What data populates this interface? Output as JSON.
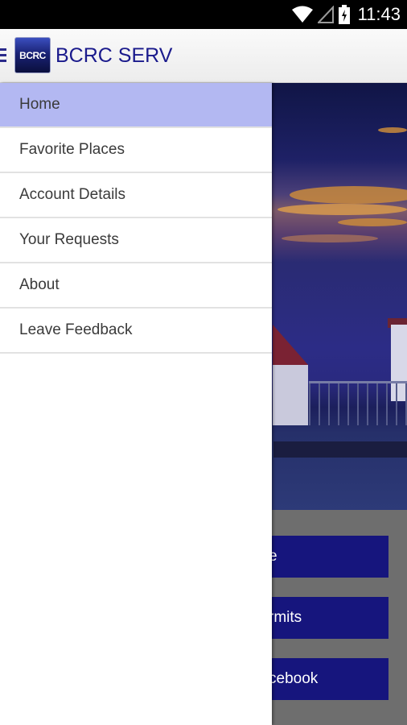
{
  "status_bar": {
    "time": "11:43",
    "icons": [
      "wifi-icon",
      "signal-icon",
      "battery-charging-icon"
    ]
  },
  "action_bar": {
    "logo_text": "BCRC",
    "title": "BCRC SERV"
  },
  "drawer": {
    "items": [
      {
        "label": "Home",
        "selected": true
      },
      {
        "label": "Favorite Places",
        "selected": false
      },
      {
        "label": "Account Details",
        "selected": false
      },
      {
        "label": "Your Requests",
        "selected": false
      },
      {
        "label": "About",
        "selected": false
      },
      {
        "label": "Leave Feedback",
        "selected": false
      }
    ]
  },
  "main": {
    "buttons": [
      {
        "label_visible": "e"
      },
      {
        "label_visible": "rmits"
      },
      {
        "label_visible": "cebook"
      }
    ]
  },
  "colors": {
    "accent": "#1a1a8c",
    "selected_item": "#b3b8f2",
    "button_blue": "#16157d"
  }
}
